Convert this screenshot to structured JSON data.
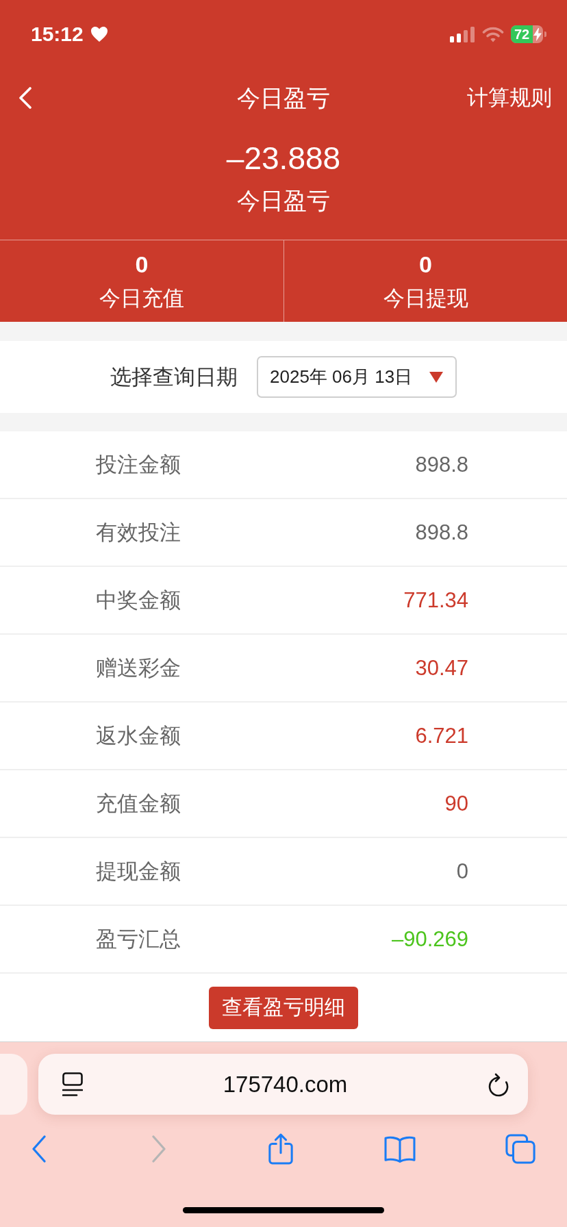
{
  "status_bar": {
    "time": "15:12",
    "battery": "72"
  },
  "nav": {
    "title": "今日盈亏",
    "action": "计算规则"
  },
  "summary": {
    "value": "–23.888",
    "label": "今日盈亏"
  },
  "stats": [
    {
      "value": "0",
      "label": "今日充值"
    },
    {
      "value": "0",
      "label": "今日提现"
    }
  ],
  "date_filter": {
    "label": "选择查询日期",
    "value": "2025年 06月 13日"
  },
  "rows": [
    {
      "label": "投注金额",
      "value": "898.8",
      "color": "#666666"
    },
    {
      "label": "有效投注",
      "value": "898.8",
      "color": "#666666"
    },
    {
      "label": "中奖金额",
      "value": "771.34",
      "color": "#cc3a2b"
    },
    {
      "label": "赠送彩金",
      "value": "30.47",
      "color": "#cc3a2b"
    },
    {
      "label": "返水金额",
      "value": "6.721",
      "color": "#cc3a2b"
    },
    {
      "label": "充值金额",
      "value": "90",
      "color": "#cc3a2b"
    },
    {
      "label": "提现金额",
      "value": "0",
      "color": "#666666"
    },
    {
      "label": "盈亏汇总",
      "value": "–90.269",
      "color": "#4cc41d"
    }
  ],
  "detail_button": "查看盈亏明细",
  "browser": {
    "url": "175740.com",
    "toolbar": [
      {
        "kind": "back",
        "disabled": false
      },
      {
        "kind": "forward",
        "disabled": true
      },
      {
        "kind": "share",
        "disabled": false
      },
      {
        "kind": "bookmarks",
        "disabled": false
      },
      {
        "kind": "tabs",
        "disabled": false
      }
    ]
  }
}
